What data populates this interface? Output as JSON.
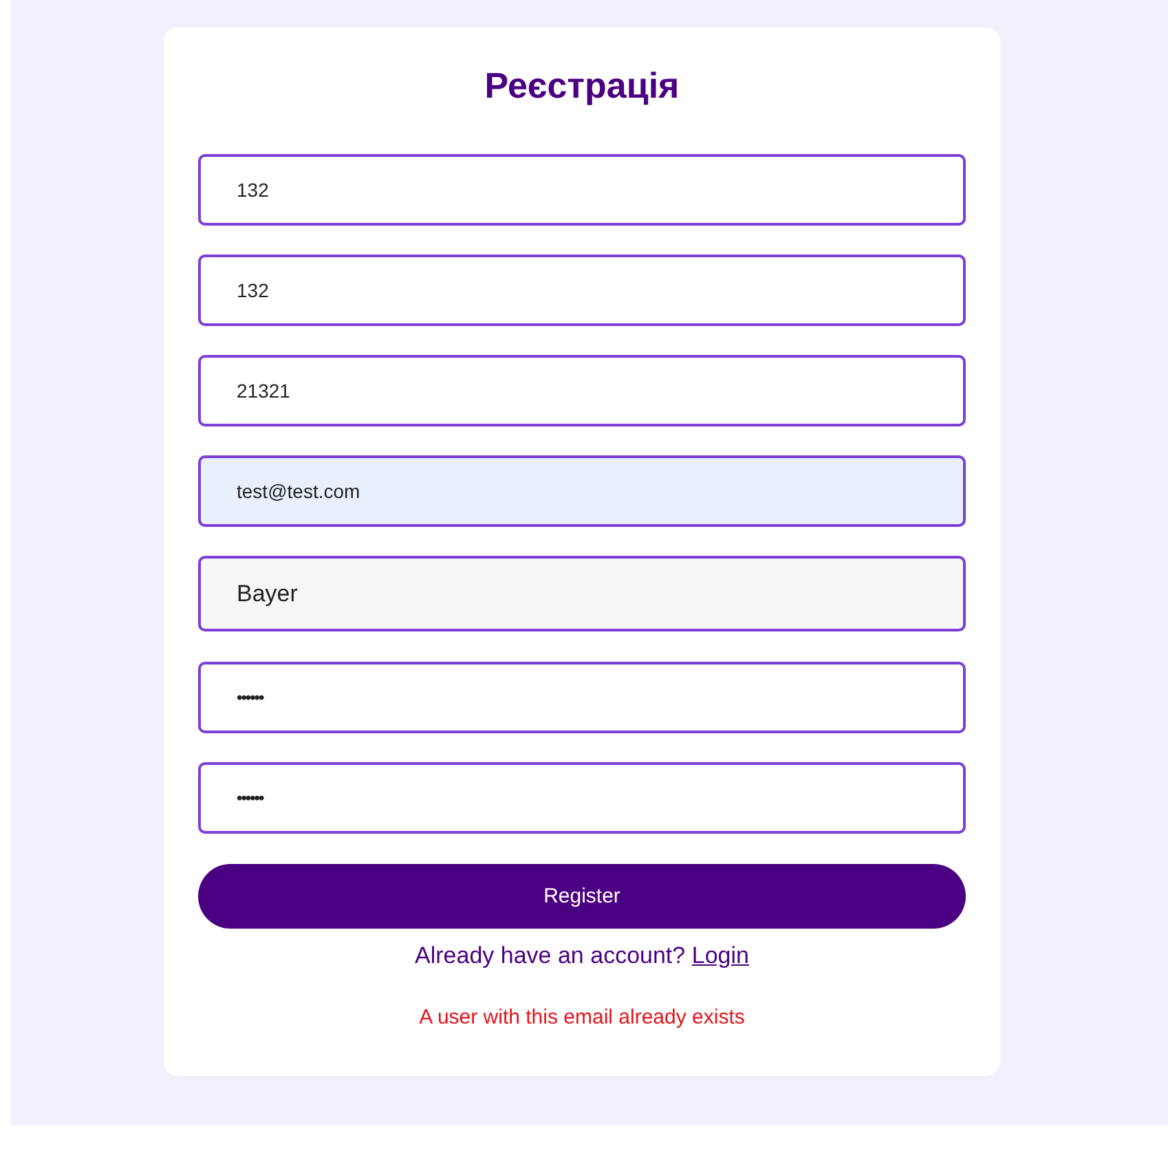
{
  "form": {
    "title": "Реєстрація",
    "fields": [
      {
        "kind": "text",
        "value": "132",
        "autofilled": false
      },
      {
        "kind": "text",
        "value": "132",
        "autofilled": false
      },
      {
        "kind": "text",
        "value": "21321",
        "autofilled": false
      },
      {
        "kind": "text",
        "value": "test@test.com",
        "autofilled": true
      },
      {
        "kind": "select",
        "value": "Bayer",
        "autofilled": false
      },
      {
        "kind": "password",
        "value": "••••••",
        "autofilled": false
      },
      {
        "kind": "password",
        "value": "••••••",
        "autofilled": false
      }
    ],
    "submit_button": "Register",
    "login_prompt": {
      "text": "Already have an account?",
      "link": "Login"
    },
    "error": "A user with this email already exists"
  }
}
